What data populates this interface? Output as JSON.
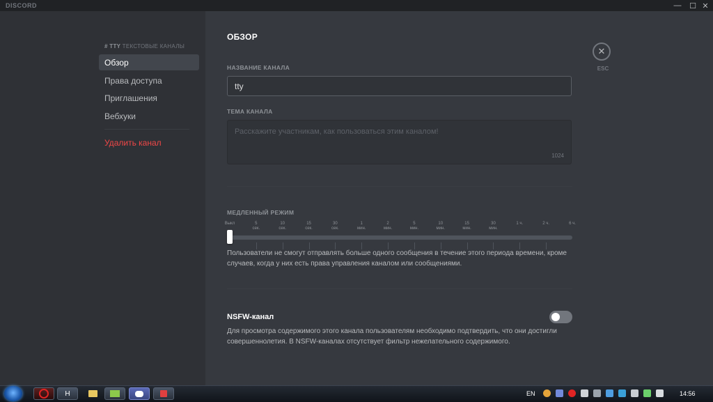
{
  "titlebar": {
    "brand": "DISCORD",
    "minimize": "—",
    "maximize": "☐",
    "close": "✕"
  },
  "sidebar": {
    "header_prefix": "# TTY",
    "header_suffix": "ТЕКСТОВЫЕ КАНАЛЫ",
    "items": [
      {
        "label": "Обзор",
        "active": true
      },
      {
        "label": "Права доступа"
      },
      {
        "label": "Приглашения"
      },
      {
        "label": "Вебхуки"
      }
    ],
    "delete_label": "Удалить канал"
  },
  "main": {
    "title": "ОБЗОР",
    "channel_name_label": "НАЗВАНИЕ КАНАЛА",
    "channel_name_value": "tty",
    "topic_label": "ТЕМА КАНАЛА",
    "topic_placeholder": "Расскажите участникам, как пользоваться этим каналом!",
    "topic_counter": "1024",
    "slowmode_label": "МЕДЛЕННЫЙ РЕЖИМ",
    "slowmode_ticks": [
      [
        "Выкл",
        ""
      ],
      [
        "5",
        "сек."
      ],
      [
        "10",
        "сек."
      ],
      [
        "15",
        "сек."
      ],
      [
        "30",
        "сек."
      ],
      [
        "1",
        "мин."
      ],
      [
        "2",
        "мин."
      ],
      [
        "5",
        "мин."
      ],
      [
        "10",
        "мин."
      ],
      [
        "15",
        "мин."
      ],
      [
        "30",
        "мин."
      ],
      [
        "1 ч.",
        ""
      ],
      [
        "2 ч.",
        ""
      ],
      [
        "6 ч.",
        ""
      ]
    ],
    "slowmode_selected": "Выкл",
    "slowmode_desc_1": "Пользователи не смогут отправлять больше одного сообщения в течение этого периода времени, кроме",
    "slowmode_desc_2": "случаев, когда у них есть права управления каналом или сообщениями.",
    "nsfw_title": "NSFW-канал",
    "nsfw_enabled": false,
    "nsfw_desc_1": "Для просмотра содержимого этого канала пользователям необходимо подтвердить, что они достигли",
    "nsfw_desc_2": "совершеннолетия. В NSFW-каналах отсутствует фильтр нежелательного содержимого.",
    "close_icon": "✕",
    "esc_label": "ESC"
  },
  "taskbar": {
    "apps": [
      "",
      "H",
      "",
      "",
      "",
      ""
    ],
    "lang": "EN",
    "clock": "14:56"
  },
  "colors": {
    "accent_danger": "#f04747",
    "bg_main": "#36393f",
    "bg_sidebar": "#2f3136"
  }
}
